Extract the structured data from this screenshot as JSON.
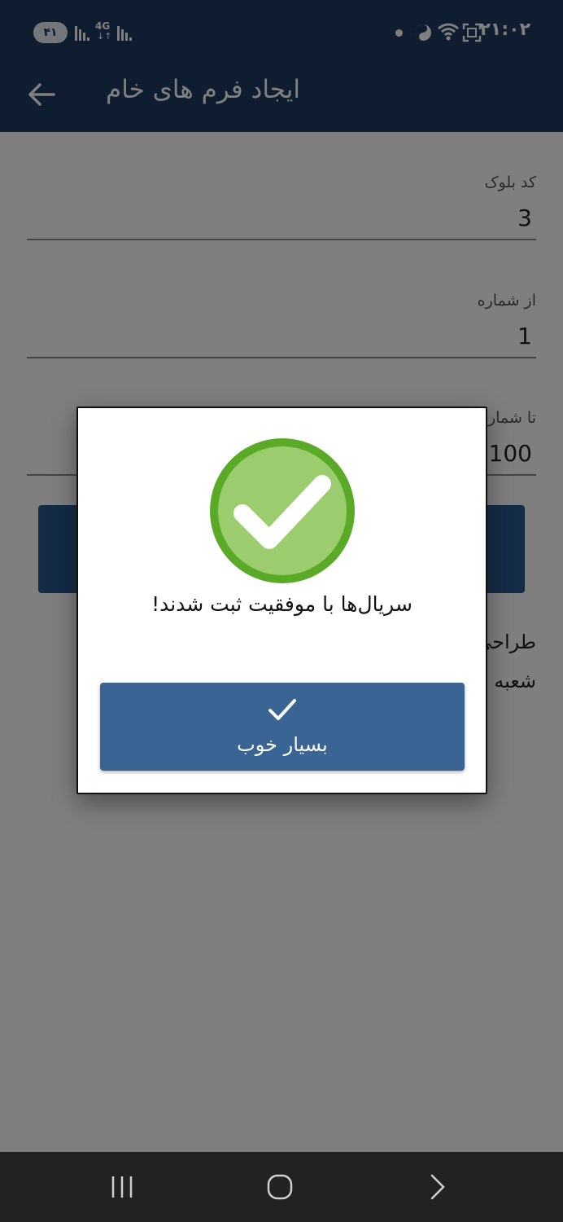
{
  "status_bar": {
    "battery": "۴۱",
    "network": "4G",
    "network_arrows": "↓↑",
    "time": "۲۱:۰۲"
  },
  "app_bar": {
    "title": "ایجاد فرم های خام"
  },
  "form": {
    "fields": [
      {
        "label": "کد بلوک",
        "value": "3"
      },
      {
        "label": "از شماره",
        "value": "1"
      },
      {
        "label": "تا شماره",
        "value": "100"
      }
    ],
    "footer_lines": [
      "طراحی",
      "شعبه"
    ]
  },
  "dialog": {
    "message": "سریال‌ها با موفقیت ثبت شدند!",
    "ok_label": "بسیار خوب",
    "badge_color": "#9bcc6d",
    "badge_ring_color": "#5aaa28"
  },
  "colors": {
    "app_bar": "#1d3b5e",
    "primary_button": "#2a588c",
    "dialog_button": "#3a6493"
  }
}
